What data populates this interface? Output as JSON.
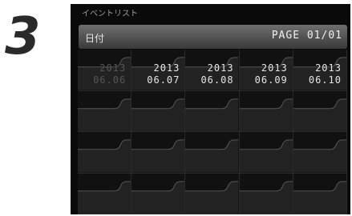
{
  "step_number": "3",
  "screen": {
    "title": "イベントリスト",
    "header_label": "日付",
    "page_indicator": "PAGE 01/01"
  },
  "events": [
    {
      "year": "2013",
      "date": "06.06",
      "dim": true
    },
    {
      "year": "2013",
      "date": "06.07",
      "dim": false
    },
    {
      "year": "2013",
      "date": "06.08",
      "dim": false
    },
    {
      "year": "2013",
      "date": "06.09",
      "dim": false
    },
    {
      "year": "2013",
      "date": "06.10",
      "dim": false
    }
  ],
  "grid": {
    "columns": 5,
    "rows": 4
  }
}
